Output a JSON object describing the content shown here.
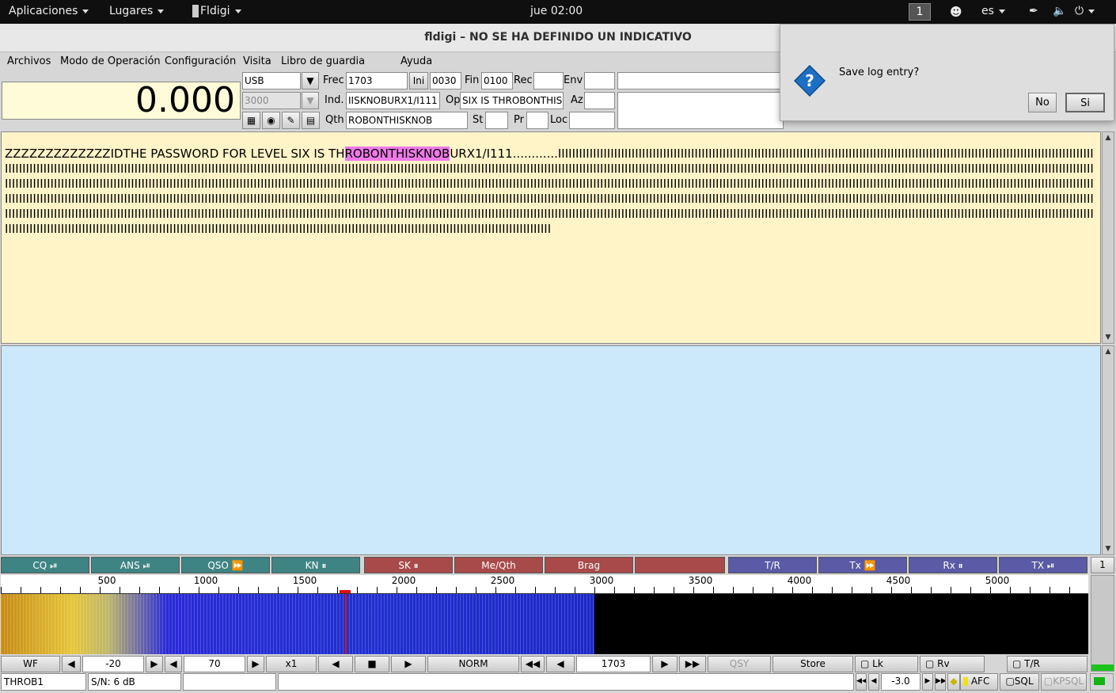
{
  "topbar": {
    "applications": "Aplicaciones",
    "places": "Lugares",
    "app": "Fldigi",
    "clock": "jue 02:00",
    "workspace": "1",
    "lang": "es"
  },
  "window": {
    "title": "fldigi – NO SE HA DEFINIDO UN INDICATIVO"
  },
  "menu": [
    "Archivos",
    "Modo de Operación",
    "Configuración",
    "Visita",
    "Libro de guardia",
    "Ayuda"
  ],
  "freq_display": "0.000",
  "log": {
    "mode": "USB",
    "bandwidth": "3000",
    "frec_label": "Frec",
    "frec": "1703",
    "ini_label": "Ini",
    "ini": "0030",
    "fin_label": "Fin",
    "fin": "0100",
    "rec_label": "Rec",
    "rec": "",
    "env_label": "Env",
    "env": "",
    "ind_label": "Ind.",
    "ind": "IISKNOBURX1/I111",
    "op_label": "Op",
    "op": "SIX IS THROBONTHIS",
    "az_label": "Az",
    "az": "",
    "qth_label": "Qth",
    "qth": "ROBONTHISKNOB",
    "st_label": "St",
    "st": "",
    "pr_label": "Pr",
    "pr": "",
    "loc_label": "Loc",
    "loc": ""
  },
  "rx": {
    "before": "ZZZZZZZZZZZZZIDTHE PASSWORD FOR LEVEL SIX IS TH",
    "highlight": "ROBONTHISKNOB",
    "after": "URX1/I111............IIIIIIIIIIIIIIIIIIIIIIIIIIIIIIIIIIIIIIIIIIIIIIIIIIIIIIIIIIIIIIIIIIIIIIIIIIIIIIIIIIIIIIIIIIIIIIIIIIIIIIIIIIIIIIIIIIIIIIIIIIIIIIIIIIIIIIIIIIIIIIIIIIIIIIIIIIIIIIIIIIIIIIIIIIIIIIIIIIIIIIIIIIIIIIIIIIIIIIIIIIIIIIIIIIIIIIIIIIIIIIIIIIIIIIIIIIIIIIIIIIIIIIIIIIIIIIIIIIIIIIIIIIIIIIIIIIIIIIIIIIIIIIIIIIIIIIIIIIIIIIIIIIIIIIIIIIIIIIIIIIIIIIIIIIIIIIIIIIIIIIIIIIIIIIIIIIIIIIIIIIIIIIIIIIIIIIIIIIIIIIIIIIIIIIIIIIIIIIIIIIIIIIIIIIIIIIIIIIIIIIIIIIIIIIIIIIIIIIIIIIIIIIIIIIIIIIIIIIIIIIIIIIIIIIIIIIIIIIIIIIIIIIIIIIIIIIIIIIIIIIIIIIIIIIIIIIIIIIIIIIIIIIIIIIIIIIIIIIIIIIIIIIIIIIIIIIIIIIIIIIIIIIIIIIIIIIIIIIIIIIIIIIIIIIIIIIIIIIIIIIIIIIIIIIIIIIIIIIIIIIIIIIIIIIIIIIIIIIIIIIIIIIIIIIIIIIIIIIIIIIIIIIIIIIIIIIIIIIIIIIIIIIIIIIIIIIIIIIIIIIIIIIIIIIIIIIIIIIIIIIIIIIIIIIIIIIIIIIIIIIIIIIIIIIIIIIIIIIIIIIIIIIIIIIIIIIIIIIIIIIIIIIIIIIIIIIIIIIIIIIIIIIIIIIIIIIIIIIIIIIIIIIIIIIIIIIIIIIIIIIIIIIIIIIIIIIIIIIIIIIIIIIIIIIIIIIIIIIIIIIIIIIIIIIIIIIIIIIIIIIIIIIIIIIIIIIIIIIIIIIIIIIIIIIIIIIIIIIIIIIIIIIIIIIIIIIIIIIIIIIIIIIIIIIIIIIIIIIIIIIIIIIIIIIIIIIIIIIIIIIIIIIIIIIIIIIIIIIIIIIIIIIIIIIIIIIIIIIIIIIIIIIIIIIIIIIIIIIIIIIIIIIIIIIIIIIIIIIIIIIIIIIIIIIIIIIIIIIIIIIIIIIIIIIIIIIIIIIIIIIIIIIIIIIIIIIIIIIIIIIIIIIIIIIIIIIIIIIIIIIIIIIIIIIIIIIIIIIIIIIIIIIIIIIIIIIIIIIIIIIIIIIIIIIIIIIIIIIIIIIIIIIIIIIIIIIIIIIIIIIIIIIIIIIIIIIIIIIIIIIIIIIIIIIIIIIIIIIIIIIIIIIIIIIIIIIIIIIIIIIIIIIIIIIIIIIIIIIIIIIIIIIIIIIIIIIIIIIIIIIIIIIIIIIIIIIIIIIIIIIIIIIIIIIIIIIIIIIIIIIIIIIIIIIIIIIIIIIIIIIIIIIIIIIIIIIIIIIIIIIIIIIIIIIIIIIIIIIIIIIIIIIIIIIIIIIIIIIIIIIIIIIIIIIIIIIIIIIIIIIIIIIIIIIIIIIIIIIIIIIIIIIIIIIIIIIIIIIIIIIIIIIIIIIIIIIIIIIIIIIIIIIIIIIIII"
  },
  "macros": [
    {
      "label": "CQ ⏯",
      "color": "teal"
    },
    {
      "label": "ANS ⏯",
      "color": "teal"
    },
    {
      "label": "QSO ⏩",
      "color": "teal"
    },
    {
      "label": "KN ⏸",
      "color": "teal"
    },
    {
      "label": "SK ⏸",
      "color": "red"
    },
    {
      "label": "Me/Qth",
      "color": "red"
    },
    {
      "label": "Brag",
      "color": "red"
    },
    {
      "label": "",
      "color": "red"
    },
    {
      "label": "T/R",
      "color": "blue"
    },
    {
      "label": "Tx ⏩",
      "color": "blue"
    },
    {
      "label": "Rx ⏸",
      "color": "blue"
    },
    {
      "label": "TX ⏯",
      "color": "blue"
    }
  ],
  "macro_bank": "1",
  "scale_labels": [
    "500",
    "1000",
    "1500",
    "2000",
    "2500",
    "3000",
    "3500",
    "4000",
    "4500",
    "5000"
  ],
  "waterfall": {
    "cursor_hz": 1703
  },
  "controls": {
    "wf": "WF",
    "ref": "-20",
    "range": "70",
    "zoom": "x1",
    "speed": "NORM",
    "freq": "1703",
    "qsy": "QSY",
    "store": "Store",
    "lk": "Lk",
    "rv": "Rv",
    "tr": "T/R"
  },
  "status": {
    "mode": "THROB1",
    "snr": "S/N:   6 dB",
    "afc_val": "-3.0",
    "afc": "AFC",
    "sql": "SQL",
    "kpsql": "KPSQL"
  },
  "dialog": {
    "message": "Save log entry?",
    "no": "No",
    "yes": "Si"
  },
  "colors": {
    "rx_bg": "#fff4c8",
    "tx_bg": "#cce9fb",
    "highlight": "#ee7ae8"
  }
}
